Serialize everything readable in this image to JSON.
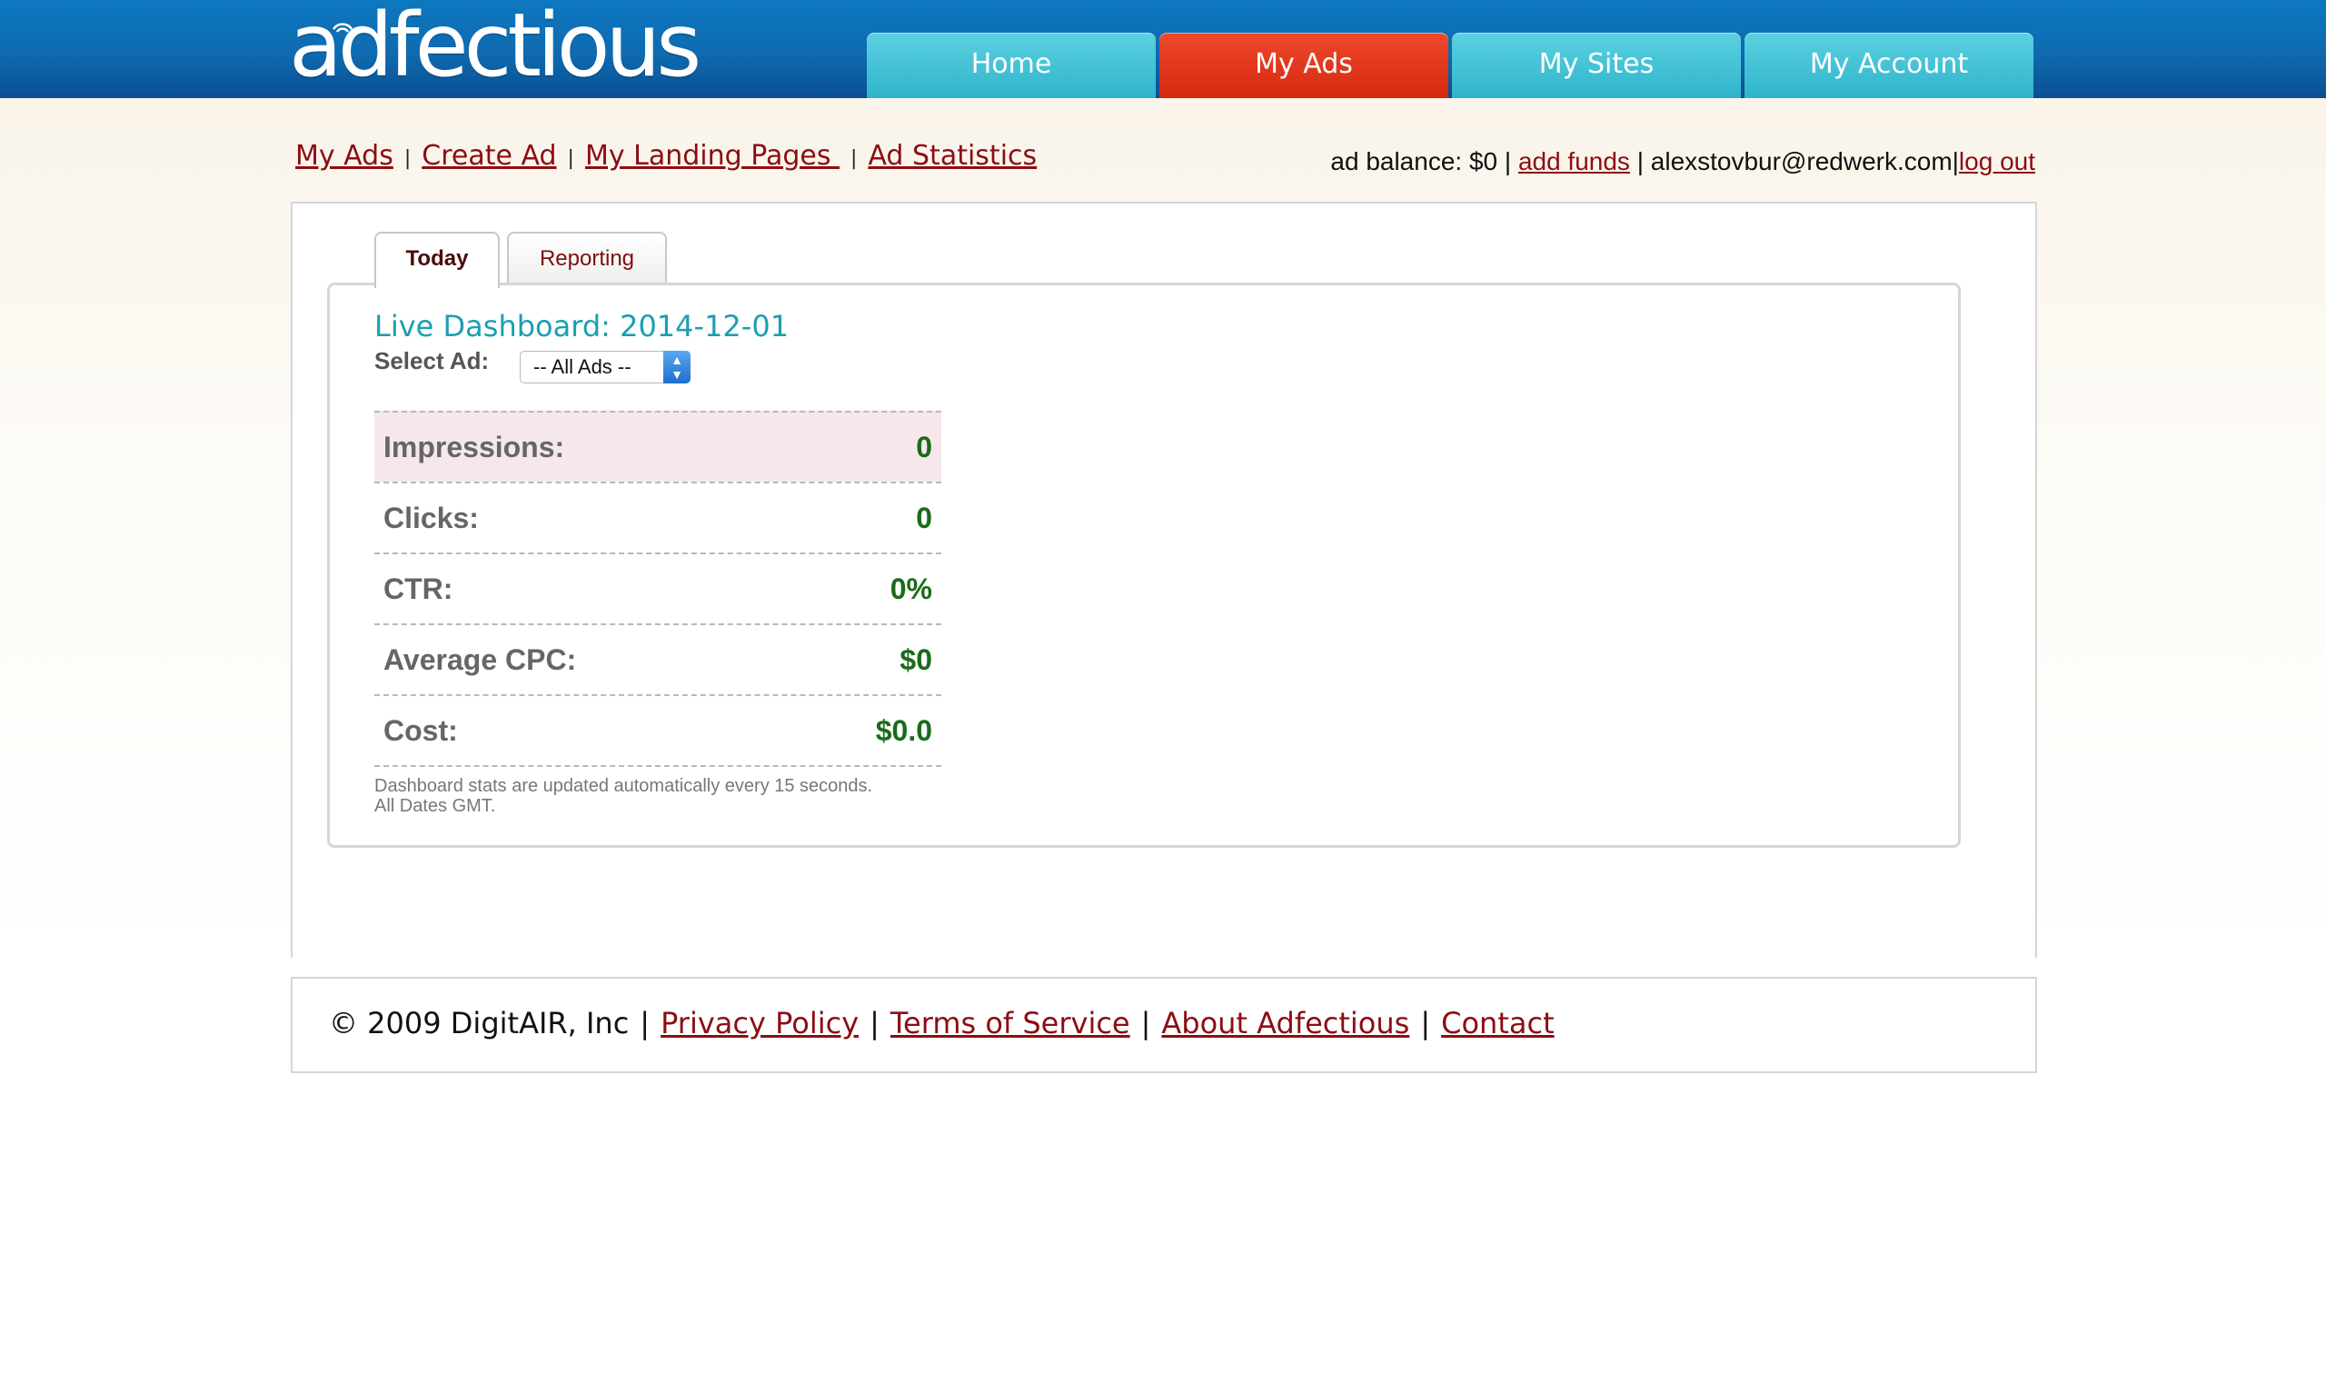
{
  "header": {
    "logo_text": "adfectious",
    "nav": [
      {
        "label": "Home",
        "active": false
      },
      {
        "label": "My Ads",
        "active": true
      },
      {
        "label": "My Sites",
        "active": false
      },
      {
        "label": "My Account",
        "active": false
      }
    ]
  },
  "subnav": {
    "items": [
      "My Ads",
      "Create Ad",
      "My Landing Pages ",
      "Ad Statistics"
    ],
    "separator": "|"
  },
  "account": {
    "balance_text": "ad balance: $0 |",
    "add_funds": "add funds",
    "email_text": "| alexstovbur@redwerk.com|",
    "logout": "log out"
  },
  "tabs": [
    "Today",
    "Reporting"
  ],
  "dashboard": {
    "title": "Live Dashboard: 2014-12-01",
    "select_label": "Select Ad:",
    "select_value": "-- All Ads --",
    "stats": [
      {
        "label": "Impressions:",
        "value": "0"
      },
      {
        "label": "Clicks:",
        "value": "0"
      },
      {
        "label": "CTR:",
        "value": "0%"
      },
      {
        "label": "Average CPC:",
        "value": "$0"
      },
      {
        "label": "Cost:",
        "value": "$0.0"
      }
    ],
    "note_line1": "Dashboard stats are updated automatically every 15 seconds.",
    "note_line2": "All Dates GMT."
  },
  "footer": {
    "copyright": "© 2009 DigitAIR, Inc",
    "links": [
      "Privacy Policy",
      "Terms of Service",
      "About Adfectious",
      "Contact"
    ],
    "separator": "|"
  },
  "colors": {
    "header_blue": "#0f6ab0",
    "nav_teal": "#2fb4cc",
    "nav_active_red": "#d42a10",
    "link_red": "#8b0e12",
    "title_teal": "#1b9fb2",
    "value_green": "#1a6b1a"
  }
}
